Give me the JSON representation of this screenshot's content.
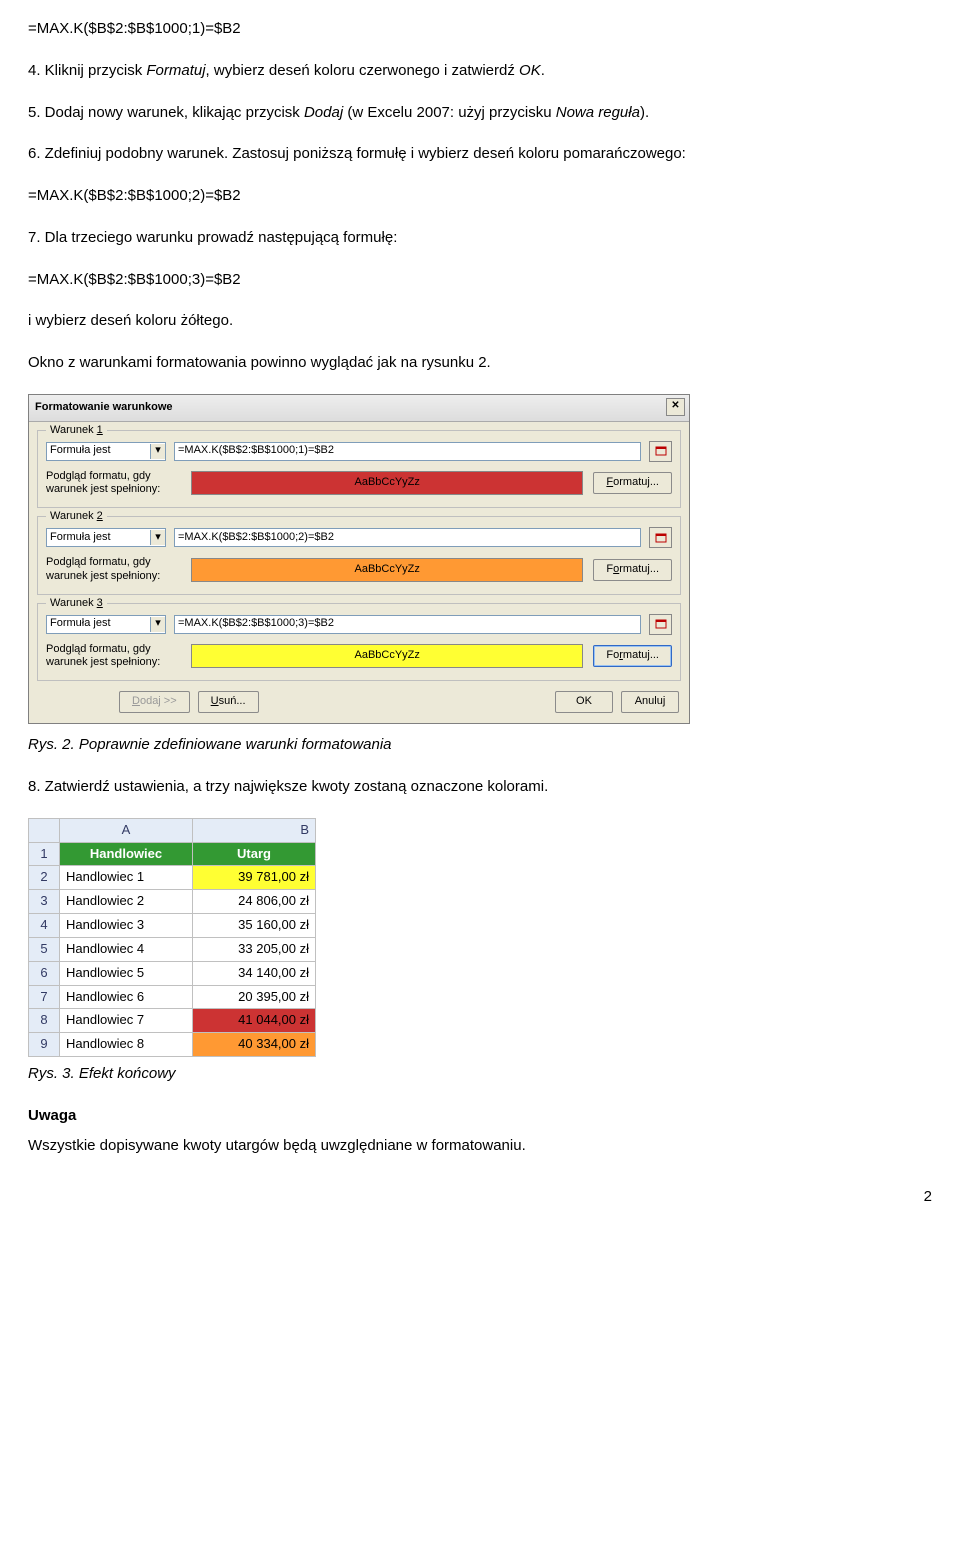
{
  "formula0": "=MAX.K($B$2:$B$1000;1)=$B2",
  "step4": "4. Kliknij przycisk Formatuj, wybierz deseń koloru czerwonego i zatwierdź OK.",
  "step5": "5. Dodaj nowy warunek, klikając przycisk Dodaj (w Excelu 2007: użyj przycisku Nowa reguła).",
  "step6": "6. Zdefiniuj podobny warunek. Zastosuj poniższą formułę i wybierz deseń koloru pomarańczowego:",
  "formula2": "=MAX.K($B$2:$B$1000;2)=$B2",
  "step7": "7. Dla trzeciego warunku prowadź następującą formułę:",
  "formula3": "=MAX.K($B$2:$B$1000;3)=$B2",
  "step7b": "i wybierz deseń koloru żółtego.",
  "sentence_after": "Okno z warunkami formatowania powinno wyglądać jak na rysunku 2.",
  "dialog": {
    "title": "Formatowanie warunkowe",
    "dropdown": "Formuła jest",
    "preview_label": "Podgląd formatu, gdy warunek jest spełniony:",
    "preview_text": "AaBbCcYyZz",
    "format_btn": "Formatuj...",
    "add_btn": "Dodaj >>",
    "del_btn": "Usuń...",
    "ok_btn": "OK",
    "cancel_btn": "Anuluj",
    "w1_label": "Warunek 1",
    "w2_label": "Warunek 2",
    "w3_label": "Warunek 3",
    "f1": "=MAX.K($B$2:$B$1000;1)=$B2",
    "f2": "=MAX.K($B$2:$B$1000;2)=$B2",
    "f3": "=MAX.K($B$2:$B$1000;3)=$B2"
  },
  "caption2": "Rys. 2. Poprawnie zdefiniowane warunki formatowania",
  "step8": "8. Zatwierdź ustawienia, a trzy największe kwoty zostaną oznaczone kolorami.",
  "sheet": {
    "colA": "A",
    "colB": "B",
    "header_a": "Handlowiec",
    "header_b": "Utarg",
    "rows": [
      {
        "n": "1"
      },
      {
        "n": "2",
        "a": "Handlowiec 1",
        "b": "39 781,00 zł",
        "cls": "hl-yellow"
      },
      {
        "n": "3",
        "a": "Handlowiec 2",
        "b": "24 806,00 zł",
        "cls": ""
      },
      {
        "n": "4",
        "a": "Handlowiec 3",
        "b": "35 160,00 zł",
        "cls": ""
      },
      {
        "n": "5",
        "a": "Handlowiec 4",
        "b": "33 205,00 zł",
        "cls": ""
      },
      {
        "n": "6",
        "a": "Handlowiec 5",
        "b": "34 140,00 zł",
        "cls": ""
      },
      {
        "n": "7",
        "a": "Handlowiec 6",
        "b": "20 395,00 zł",
        "cls": ""
      },
      {
        "n": "8",
        "a": "Handlowiec 7",
        "b": "41 044,00 zł",
        "cls": "hl-red"
      },
      {
        "n": "9",
        "a": "Handlowiec 8",
        "b": "40 334,00 zł",
        "cls": "hl-orange"
      }
    ]
  },
  "caption3": "Rys. 3. Efekt końcowy",
  "uwaga_title": "Uwaga",
  "uwaga_text": "Wszystkie dopisywane kwoty utargów będą uwzględniane w formatowaniu.",
  "pagenum": "2"
}
